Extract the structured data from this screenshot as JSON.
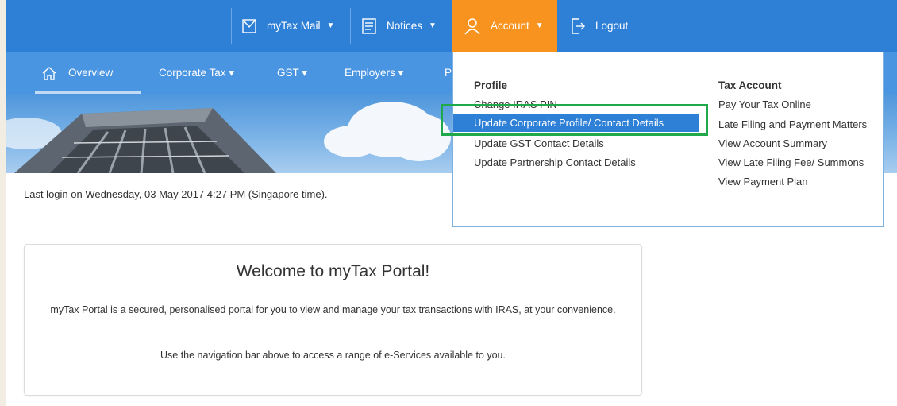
{
  "topbar": {
    "mail_label": "myTax Mail",
    "notices_label": "Notices",
    "account_label": "Account",
    "logout_label": "Logout"
  },
  "nav": {
    "items": [
      {
        "label": "Overview"
      },
      {
        "label": "Corporate Tax ▾"
      },
      {
        "label": "GST ▾"
      },
      {
        "label": "Employers ▾"
      },
      {
        "label": "P"
      }
    ]
  },
  "account_menu": {
    "profile": {
      "heading": "Profile",
      "links": [
        "Change IRAS PIN",
        "Update Corporate Profile/ Contact Details",
        "Update GST Contact Details",
        "Update Partnership Contact Details"
      ]
    },
    "tax_account": {
      "heading": "Tax Account",
      "links": [
        "Pay Your Tax Online",
        "Late Filing and Payment Matters",
        "View Account Summary",
        "View Late Filing Fee/ Summons",
        "View Payment Plan"
      ]
    }
  },
  "last_login": "Last login on Wednesday, 03 May 2017 4:27 PM (Singapore time).",
  "welcome": {
    "title": "Welcome to myTax Portal!",
    "paragraph1": "myTax Portal is a secured, personalised portal for you to view and manage your tax transactions with IRAS, at your convenience.",
    "paragraph2": "Use the navigation bar above to access a range of e-Services available to you."
  },
  "colors": {
    "topbar": "#2e7fd6",
    "navbar": "#4a95e2",
    "account_active": "#f7931e",
    "selected_link": "#2e7fd6",
    "highlight": "#1fa94b"
  },
  "icons": [
    "mail-icon",
    "notices-icon",
    "user-icon",
    "logout-icon",
    "home-icon"
  ]
}
